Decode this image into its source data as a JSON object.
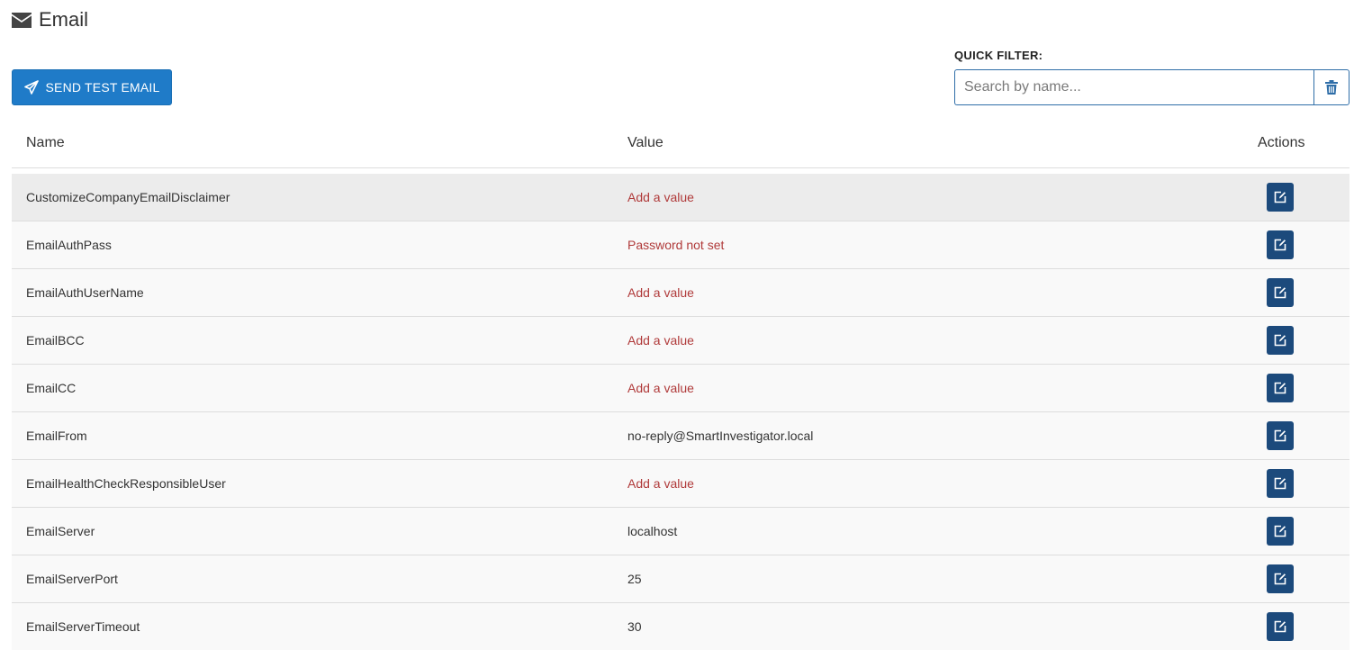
{
  "header": {
    "title": "Email",
    "icon": "envelope-icon"
  },
  "toolbar": {
    "send_test_label": "SEND TEST EMAIL",
    "send_icon": "paper-plane-icon"
  },
  "quick_filter": {
    "label": "QUICK FILTER:",
    "placeholder": "Search by name...",
    "value": "",
    "clear_icon": "trash-icon"
  },
  "table": {
    "columns": [
      "Name",
      "Value",
      "Actions"
    ],
    "rows": [
      {
        "name": "CustomizeCompanyEmailDisclaimer",
        "value": "Add a value",
        "missing": true
      },
      {
        "name": "EmailAuthPass",
        "value": "Password not set",
        "missing": true
      },
      {
        "name": "EmailAuthUserName",
        "value": "Add a value",
        "missing": true
      },
      {
        "name": "EmailBCC",
        "value": "Add a value",
        "missing": true
      },
      {
        "name": "EmailCC",
        "value": "Add a value",
        "missing": true
      },
      {
        "name": "EmailFrom",
        "value": "no-reply@SmartInvestigator.local",
        "missing": false
      },
      {
        "name": "EmailHealthCheckResponsibleUser",
        "value": "Add a value",
        "missing": true
      },
      {
        "name": "EmailServer",
        "value": "localhost",
        "missing": false
      },
      {
        "name": "EmailServerPort",
        "value": "25",
        "missing": false
      },
      {
        "name": "EmailServerTimeout",
        "value": "30",
        "missing": false
      }
    ],
    "edit_icon": "edit-icon"
  },
  "colors": {
    "primary_button": "#1f7bc8",
    "edit_button": "#1c4a7c",
    "missing_value": "#b03a3a"
  }
}
